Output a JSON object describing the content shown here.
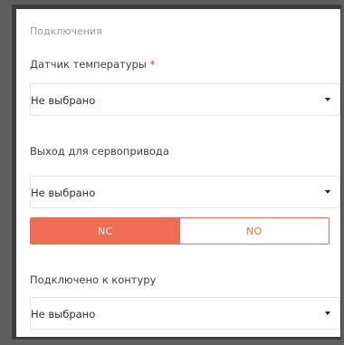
{
  "section": {
    "title": "Подключения"
  },
  "fields": {
    "temperature_sensor": {
      "label": "Датчик температуры",
      "required_mark": "*",
      "value": "Не выбрано"
    },
    "servo_output": {
      "label": "Выход для сервопривода",
      "value": "Не выбрано"
    },
    "contour": {
      "label": "Подключено к контуру",
      "value": "Не выбрано"
    }
  },
  "toggle": {
    "options": [
      "NC",
      "NO"
    ],
    "selected": "NC"
  },
  "colors": {
    "accent": "#ef6d52",
    "required": "#e5452c"
  }
}
